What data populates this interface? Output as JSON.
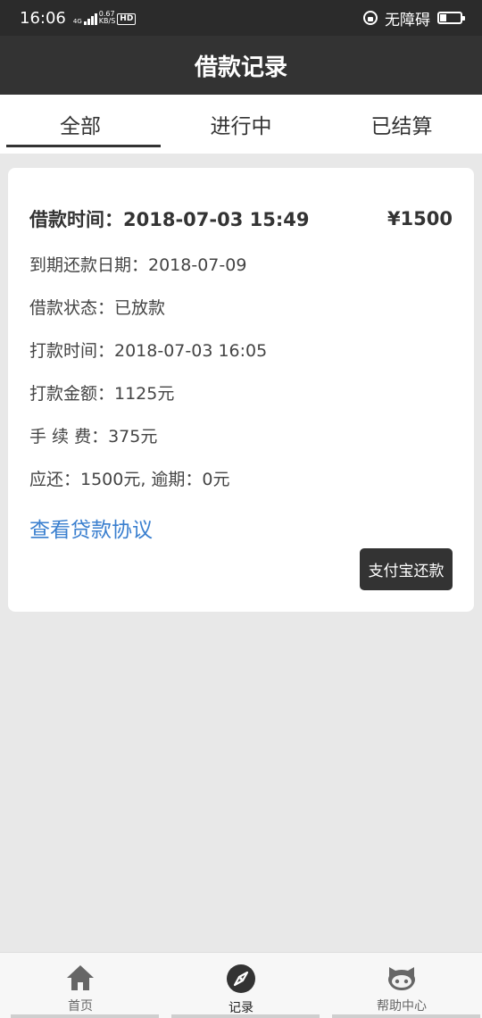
{
  "status_bar": {
    "time": "16:06",
    "network_type": "4G",
    "speed_value": "0.67",
    "speed_unit": "KB/S",
    "hd_badge": "HD",
    "accessibility_label": "无障碍"
  },
  "header": {
    "title": "借款记录"
  },
  "tabs": [
    {
      "label": "全部",
      "active": true
    },
    {
      "label": "进行中",
      "active": false
    },
    {
      "label": "已结算",
      "active": false
    }
  ],
  "record": {
    "loan_time_label": "借款时间：2018-07-03 15:49",
    "amount": "¥1500",
    "due_date": "到期还款日期：2018-07-09",
    "status": "借款状态：已放款",
    "payout_time": "打款时间：2018-07-03 16:05",
    "payout_amount": "打款金额：1125元",
    "fee": "手 续 费：375元",
    "repay_info": "应还：1500元, 逾期：0元",
    "agreement_link": "查看贷款协议",
    "pay_button": "支付宝还款"
  },
  "bottom_nav": [
    {
      "label": "首页",
      "icon": "home-icon",
      "active": false
    },
    {
      "label": "记录",
      "icon": "compass-icon",
      "active": true
    },
    {
      "label": "帮助中心",
      "icon": "octocat-icon",
      "active": false
    }
  ]
}
